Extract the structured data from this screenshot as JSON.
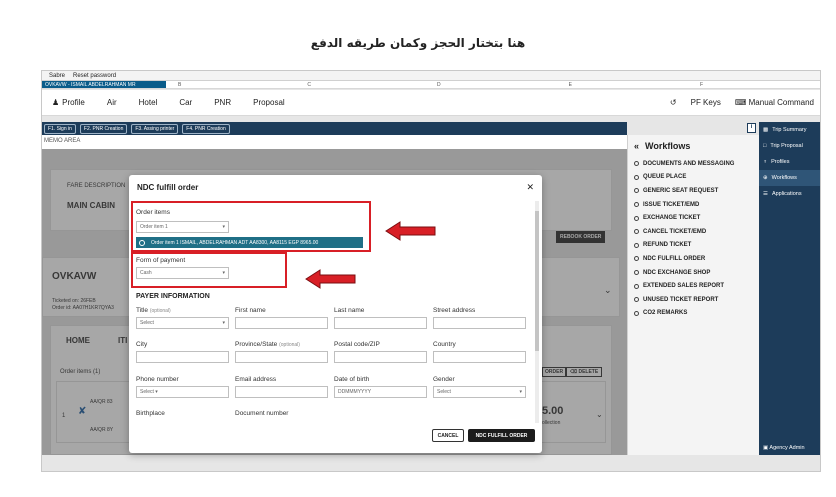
{
  "caption": "هنا بتختار الحجز وكمان طريقه الدفع",
  "browser": {
    "tab1": "Sabre",
    "tab2": "Reset password"
  },
  "sheet": {
    "active": "OVKAVW - ISMAIL ABDELRAHMAN MR",
    "cols": [
      "B",
      "C",
      "D",
      "E",
      "F"
    ]
  },
  "nav": {
    "profile": "Profile",
    "air": "Air",
    "hotel": "Hotel",
    "car": "Car",
    "pnr": "PNR",
    "proposal": "Proposal",
    "pf_keys": "PF Keys",
    "manual": "Manual Command"
  },
  "cmd": [
    "F1. Sign in",
    "F2. PNR Creation",
    "F3. Assing printer",
    "F4. PNR Creation"
  ],
  "memo": "MEMO AREA",
  "background": {
    "fare_desc": "FARE DESCRIPTION",
    "cabin": "MAIN CABIN",
    "rebook": "REBOOK ORDER",
    "pnr": "OVKAVW",
    "ticketed": "Ticketed on: 26FEB",
    "order_id": "Order id: AA07H1KR7QYA3",
    "home": "HOME",
    "iti": "ITI",
    "order_items": "Order items (1)",
    "row_num": "1",
    "airline": "AA/QR 83",
    "airline2": "AA/QR 8Y",
    "order_btn": "ORDER",
    "delete_btn": "DELETE",
    "amount": "5.00",
    "collection": "ollection"
  },
  "workflows": {
    "title": "Workflows",
    "items": [
      "DOCUMENTS AND MESSAGING",
      "QUEUE PLACE",
      "GENERIC SEAT REQUEST",
      "ISSUE TICKET/EMD",
      "EXCHANGE TICKET",
      "CANCEL TICKET/EMD",
      "REFUND TICKET",
      "NDC FULFILL ORDER",
      "NDC EXCHANGE SHOP",
      "EXTENDED SALES REPORT",
      "UNUSED TICKET REPORT",
      "CO2 REMARKS"
    ]
  },
  "rightbar": {
    "items": [
      "Trip Summary",
      "Trip Proposal",
      "Profiles",
      "Workflows",
      "Applications"
    ],
    "bottom": "Agency Admin"
  },
  "modal": {
    "title": "NDC fulfill order",
    "order_items_label": "Order items",
    "order_item_select": "Order item 1",
    "order_chip": "Order item 1   ISMAIL, ABDELRAHMAN   ADT   AA8300, AA8115   EGP 8965.00",
    "fop_label": "Form of payment",
    "fop_value": "Cash",
    "payer_info": "PAYER INFORMATION",
    "title_label": "Title",
    "optional": "(optional)",
    "title_value": "Select",
    "first_name": "First name",
    "last_name": "Last name",
    "street": "Street address",
    "city": "City",
    "province": "Province/State",
    "postal": "Postal code/ZIP",
    "country": "Country",
    "phone": "Phone number",
    "phone_value": "Select",
    "email": "Email address",
    "dob": "Date of birth",
    "dob_placeholder": "DDMMMYYYY",
    "gender": "Gender",
    "gender_value": "Select",
    "birthplace": "Birthplace",
    "doc_number": "Document number",
    "cancel": "CANCEL",
    "fulfill": "NDC FULFILL ORDER"
  }
}
